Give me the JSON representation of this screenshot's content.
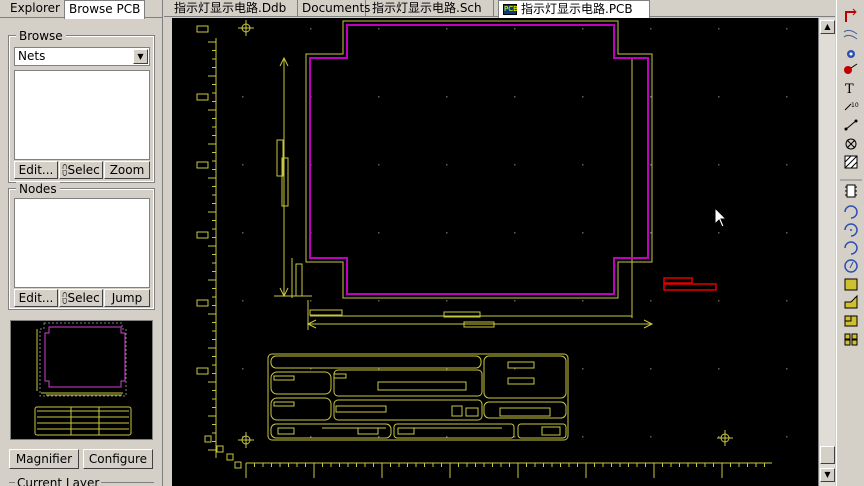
{
  "left_panel": {
    "tabs": [
      "Explorer",
      "Browse PCB"
    ],
    "browse": {
      "label": "Browse",
      "select_value": "Nets",
      "buttons": [
        "Edit...",
        "Selec",
        "Zoom"
      ]
    },
    "nodes": {
      "label": "Nodes",
      "buttons": [
        "Edit...",
        "Selec",
        "Jump"
      ]
    },
    "magnifier_label": "Magnifier",
    "configure_label": "Configure",
    "current_layer_label": "Current Layer"
  },
  "doc_tabs": [
    "指示灯显示电路.Ddb",
    "Documents",
    "指示灯显示电路.Sch",
    "指示灯显示电路.PCB"
  ],
  "pcb_icon_text": "PCB",
  "colors": {
    "board_outline": "#c000c0",
    "mechanical": "#c8c840",
    "selection_red": "#e00000",
    "grid_dot": "#606060"
  },
  "right_tools": [
    "track-icon",
    "wire-icon",
    "via-icon",
    "pad-icon",
    "text-icon",
    "coordinate-icon",
    "dimension-icon",
    "keepout-icon",
    "polygon-icon",
    "component-icon",
    "arc-center-icon",
    "arc-edge-icon",
    "arc-any-icon",
    "full-circle-icon",
    "fill-icon",
    "split-plane-icon",
    "room-icon",
    "array-icon"
  ]
}
